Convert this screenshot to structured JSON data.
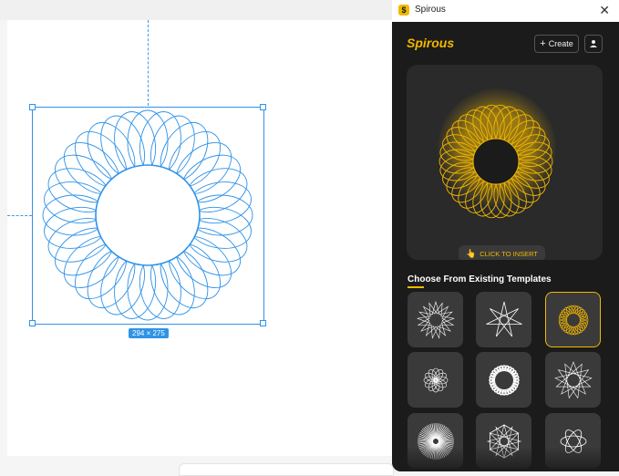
{
  "window": {
    "title": "Spirous",
    "close_label": "✕"
  },
  "panel": {
    "brand": "Spirous",
    "create_label": "Create",
    "create_icon": "plus-icon",
    "user_icon": "user-icon",
    "insert_label": "CLICK TO INSERT",
    "templates_title": "Choose From Existing Templates",
    "accent_color": "#f2b800",
    "templates": [
      {
        "id": "t1",
        "icon": "dense-star-spirograph-icon",
        "selected": false
      },
      {
        "id": "t2",
        "icon": "seven-point-star-spirograph-icon",
        "selected": false
      },
      {
        "id": "t3",
        "icon": "golden-ring-spirograph-icon",
        "selected": true
      },
      {
        "id": "t4",
        "icon": "small-rosette-icon",
        "selected": false
      },
      {
        "id": "t5",
        "icon": "thick-ring-icon",
        "selected": false
      },
      {
        "id": "t6",
        "icon": "spiky-star-icon",
        "selected": false
      },
      {
        "id": "t7",
        "icon": "radial-burst-icon",
        "selected": false
      },
      {
        "id": "t8",
        "icon": "outline-star-icon",
        "selected": false
      },
      {
        "id": "t9",
        "icon": "orbit-loops-icon",
        "selected": false
      }
    ]
  },
  "canvas": {
    "selection_size": "294 × 275",
    "selection_color": "#2f93e8"
  }
}
